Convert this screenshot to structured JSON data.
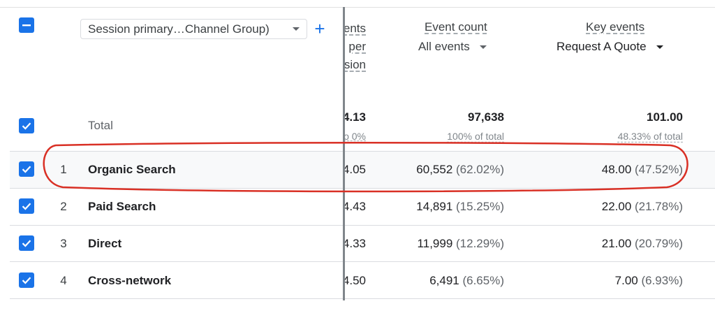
{
  "header": {
    "dimension_select": "Session primary…Channel Group)",
    "add_label": "+",
    "clipped_metric_lines": [
      "ents",
      "per",
      "sion"
    ],
    "event_count": {
      "title": "Event count",
      "filter": "All events"
    },
    "key_events": {
      "title": "Key events",
      "filter": "Request A Quote"
    }
  },
  "total": {
    "label": "Total",
    "clipped_value": "4.13",
    "clipped_sub": "o 0%",
    "event_count": "97,638",
    "event_count_sub": "100% of total",
    "key_events": "101.00",
    "key_events_sub": "48.33% of total"
  },
  "rows": [
    {
      "rank": "1",
      "name": "Organic Search",
      "clipped": "4.05",
      "event_count": "60,552",
      "event_pct": "(62.02%)",
      "key_events": "48.00",
      "key_pct": "(47.52%)"
    },
    {
      "rank": "2",
      "name": "Paid Search",
      "clipped": "4.43",
      "event_count": "14,891",
      "event_pct": "(15.25%)",
      "key_events": "22.00",
      "key_pct": "(21.78%)"
    },
    {
      "rank": "3",
      "name": "Direct",
      "clipped": "4.33",
      "event_count": "11,999",
      "event_pct": "(12.29%)",
      "key_events": "21.00",
      "key_pct": "(20.79%)"
    },
    {
      "rank": "4",
      "name": "Cross-network",
      "clipped": "4.50",
      "event_count": "6,491",
      "event_pct": "(6.65%)",
      "key_events": "7.00",
      "key_pct": "(6.93%)"
    }
  ],
  "colors": {
    "accent": "#1a73e8",
    "annotation": "#d93025",
    "row_highlight": "#f8f9fa"
  },
  "icons": [
    "indeterminate-checkbox-icon",
    "checkbox-checked-icon",
    "dropdown-caret-icon",
    "add-icon"
  ]
}
